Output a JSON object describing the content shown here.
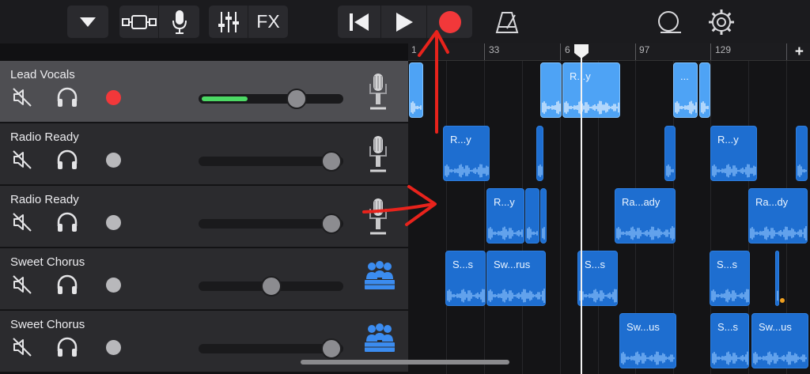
{
  "toolbar": {
    "fx_label": "FX",
    "icons": [
      "tracks-menu-icon",
      "browser-icon",
      "mic-icon",
      "mixer-icon",
      "rewind-icon",
      "play-icon",
      "record-icon",
      "metronome-icon",
      "loop-icon",
      "settings-icon"
    ],
    "record_color": "#f2383a"
  },
  "ruler": {
    "bar_numbers": [
      "1",
      "33",
      "6",
      "97",
      "129"
    ],
    "add_label": "+"
  },
  "tracks": [
    {
      "name": "Lead Vocals",
      "selected": true,
      "armed": true,
      "meter": 0.33,
      "volume": 0.68,
      "instrument": "microphone-icon"
    },
    {
      "name": "Radio Ready",
      "selected": false,
      "armed": false,
      "meter": 0,
      "volume": 0.92,
      "instrument": "microphone-icon"
    },
    {
      "name": "Radio Ready",
      "selected": false,
      "armed": false,
      "meter": 0,
      "volume": 0.92,
      "instrument": "microphone-icon"
    },
    {
      "name": "Sweet Chorus",
      "selected": false,
      "armed": false,
      "meter": 0,
      "volume": 0.5,
      "instrument": "choir-icon"
    },
    {
      "name": "Sweet Chorus",
      "selected": false,
      "armed": false,
      "meter": 0,
      "volume": 0.92,
      "instrument": "choir-icon"
    }
  ],
  "regions": {
    "r1a": "",
    "r1b": "",
    "r1c": "R...y",
    "r1d": "...",
    "r1e": "",
    "r2a": "R...y",
    "r2b": "",
    "r2c": "",
    "r2d": "R...y",
    "r2e": "",
    "r3a": "R...y",
    "r3b": "",
    "r3c": "",
    "r3d": "Ra...ady",
    "r3e": "Ra...dy",
    "r4a": "S...s",
    "r4b": "Sw...rus",
    "r4c": "S...s",
    "r4d": "S...s",
    "r4e": "",
    "r5a": "Sw...us",
    "r5b": "S...s",
    "r5c": "Sw...us"
  },
  "colors": {
    "accent": "#4ea3f5",
    "record": "#f2383a",
    "meter": "#4cd964",
    "annotation": "#e8231c"
  }
}
